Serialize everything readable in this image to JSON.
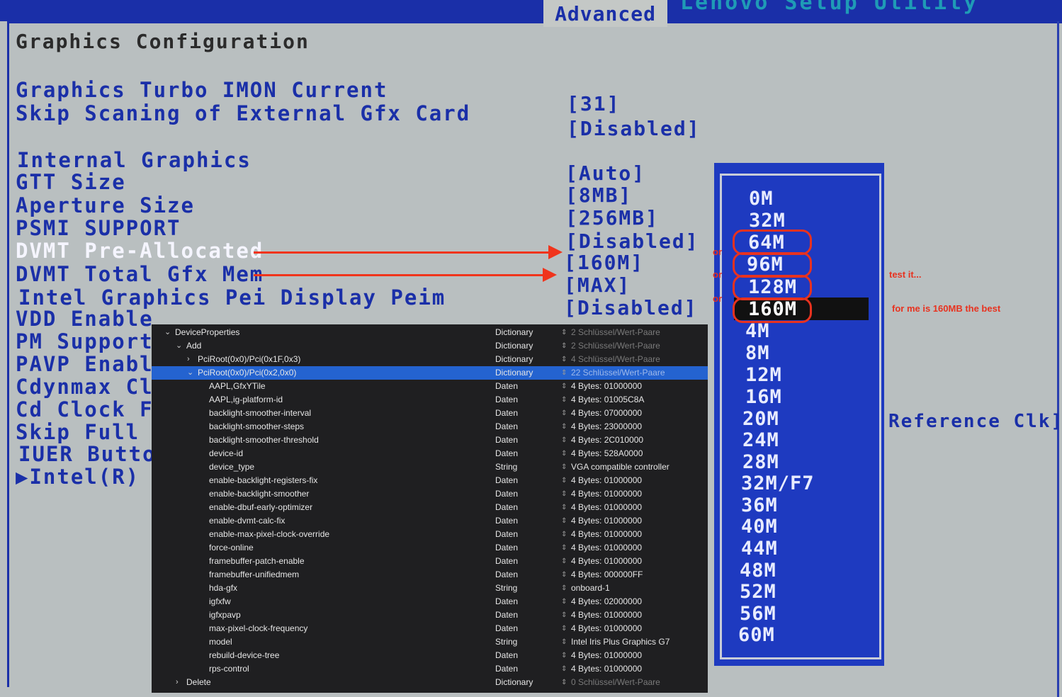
{
  "header": {
    "title_partial": "Lenovo Setup Utility",
    "tab_active": "Advanced"
  },
  "page": {
    "title": "Graphics Configuration"
  },
  "settings": [
    {
      "label": "Graphics Turbo IMON Current",
      "value": "[31]"
    },
    {
      "label": "Skip Scaning of External Gfx Card",
      "value": "[Disabled]"
    },
    {
      "label": "Internal Graphics",
      "value": "[Auto]"
    },
    {
      "label": "GTT Size",
      "value": "[8MB]"
    },
    {
      "label": "Aperture Size",
      "value": "[256MB]"
    },
    {
      "label": "PSMI SUPPORT",
      "value": "[Disabled]"
    },
    {
      "label": "DVMT Pre-Allocated",
      "value": "[160M]"
    },
    {
      "label": "DVMT Total Gfx Mem",
      "value": "[MAX]"
    },
    {
      "label": "Intel Graphics Pei Display Peim",
      "value": "[Disabled]"
    },
    {
      "label": "VDD Enable",
      "value": ""
    },
    {
      "label": "PM Support",
      "value": ""
    },
    {
      "label": "PAVP Enable",
      "value": ""
    },
    {
      "label": "Cdynmax Cla",
      "value": ""
    },
    {
      "label": "Cd Clock Fr",
      "value": ""
    },
    {
      "label": "Skip Full C",
      "value": ""
    },
    {
      "label": "IUER Button",
      "value": ""
    },
    {
      "label": "▶Intel(R) U",
      "value": ""
    }
  ],
  "reference_clk": "Reference Clk]",
  "popup": {
    "options": [
      "0M",
      "32M",
      "64M",
      "96M",
      "128M",
      "160M",
      "4M",
      "8M",
      "12M",
      "16M",
      "20M",
      "24M",
      "28M",
      "32M/F7",
      "36M",
      "40M",
      "44M",
      "48M",
      "52M",
      "56M",
      "60M"
    ],
    "selected": "160M"
  },
  "annotations": {
    "or1": "or",
    "or2": "or",
    "or3": "or",
    "test": "test it...",
    "best": "for me is 160MB the best"
  },
  "plist": {
    "rows": [
      {
        "key": "DeviceProperties",
        "type": "Dictionary",
        "value": "2 Schlüssel/Wert-Paare",
        "dim": true
      },
      {
        "key": "Add",
        "type": "Dictionary",
        "value": "2 Schlüssel/Wert-Paare",
        "dim": true
      },
      {
        "key": "PciRoot(0x0)/Pci(0x1F,0x3)",
        "type": "Dictionary",
        "value": "4 Schlüssel/Wert-Paare",
        "dim": true
      },
      {
        "key": "PciRoot(0x0)/Pci(0x2,0x0)",
        "type": "Dictionary",
        "value": "22 Schlüssel/Wert-Paare",
        "dim": true
      },
      {
        "key": "AAPL,GfxYTile",
        "type": "Daten",
        "value": "4 Bytes: 01000000"
      },
      {
        "key": "AAPL,ig-platform-id",
        "type": "Daten",
        "value": "4 Bytes: 01005C8A"
      },
      {
        "key": "backlight-smoother-interval",
        "type": "Daten",
        "value": "4 Bytes: 07000000"
      },
      {
        "key": "backlight-smoother-steps",
        "type": "Daten",
        "value": "4 Bytes: 23000000"
      },
      {
        "key": "backlight-smoother-threshold",
        "type": "Daten",
        "value": "4 Bytes: 2C010000"
      },
      {
        "key": "device-id",
        "type": "Daten",
        "value": "4 Bytes: 528A0000"
      },
      {
        "key": "device_type",
        "type": "String",
        "value": "VGA compatible controller"
      },
      {
        "key": "enable-backlight-registers-fix",
        "type": "Daten",
        "value": "4 Bytes: 01000000"
      },
      {
        "key": "enable-backlight-smoother",
        "type": "Daten",
        "value": "4 Bytes: 01000000"
      },
      {
        "key": "enable-dbuf-early-optimizer",
        "type": "Daten",
        "value": "4 Bytes: 01000000"
      },
      {
        "key": "enable-dvmt-calc-fix",
        "type": "Daten",
        "value": "4 Bytes: 01000000"
      },
      {
        "key": "enable-max-pixel-clock-override",
        "type": "Daten",
        "value": "4 Bytes: 01000000"
      },
      {
        "key": "force-online",
        "type": "Daten",
        "value": "4 Bytes: 01000000"
      },
      {
        "key": "framebuffer-patch-enable",
        "type": "Daten",
        "value": "4 Bytes: 01000000"
      },
      {
        "key": "framebuffer-unifiedmem",
        "type": "Daten",
        "value": "4 Bytes: 000000FF"
      },
      {
        "key": "hda-gfx",
        "type": "String",
        "value": "onboard-1"
      },
      {
        "key": "igfxfw",
        "type": "Daten",
        "value": "4 Bytes: 02000000"
      },
      {
        "key": "igfxpavp",
        "type": "Daten",
        "value": "4 Bytes: 01000000"
      },
      {
        "key": "max-pixel-clock-frequency",
        "type": "Daten",
        "value": "4 Bytes: 01000000"
      },
      {
        "key": "model",
        "type": "String",
        "value": "Intel Iris Plus Graphics G7"
      },
      {
        "key": "rebuild-device-tree",
        "type": "Daten",
        "value": "4 Bytes: 01000000"
      },
      {
        "key": "rps-control",
        "type": "Daten",
        "value": "4 Bytes: 01000000"
      },
      {
        "key": "Delete",
        "type": "Dictionary",
        "value": "0 Schlüssel/Wert-Paare",
        "dim": true
      }
    ]
  },
  "colors": {
    "bios_blue": "#1a2fa8",
    "bios_bg": "#b9bfc0",
    "annotation_red": "#e8321f",
    "plist_bg": "#1f1f21",
    "plist_selected": "#2463d0"
  }
}
